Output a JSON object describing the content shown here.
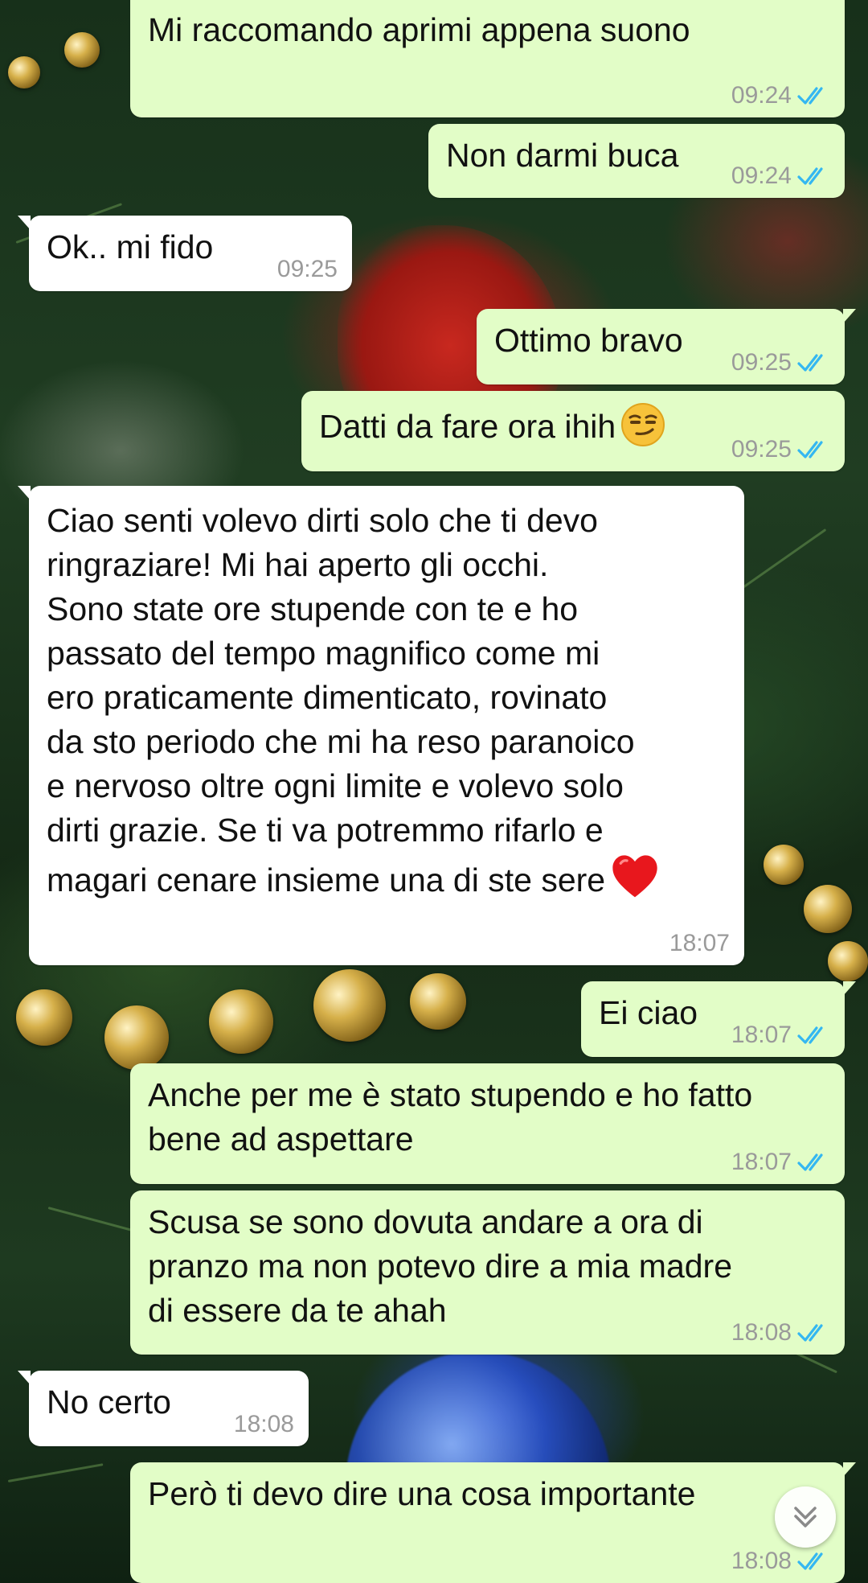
{
  "messages": [
    {
      "direction": "out",
      "text": "Mi raccomando aprimi appena suono",
      "time": "09:24",
      "status": "read"
    },
    {
      "direction": "out",
      "text": "Non darmi buca",
      "time": "09:24",
      "status": "read"
    },
    {
      "direction": "in",
      "text": "Ok.. mi fido",
      "time": "09:25"
    },
    {
      "direction": "out",
      "text": "Ottimo bravo",
      "time": "09:25",
      "status": "read"
    },
    {
      "direction": "out",
      "text": "Datti da fare ora ihih",
      "emoji": "smirking-face",
      "time": "09:25",
      "status": "read"
    },
    {
      "direction": "in",
      "text": "Ciao senti volevo dirti solo che ti devo\nringraziare! Mi hai aperto gli occhi.\nSono state ore stupende con te e ho\npassato del tempo magnifico come mi\nero praticamente dimenticato, rovinato\nda sto periodo che mi ha reso paranoico\ne nervoso oltre ogni limite e volevo solo\ndirti grazie. Se ti va potremmo rifarlo e\nmagari cenare insieme una di ste sere",
      "emoji": "red-heart",
      "time": "18:07"
    },
    {
      "direction": "out",
      "text": "Ei ciao",
      "time": "18:07",
      "status": "read"
    },
    {
      "direction": "out",
      "text": "Anche per me è stato stupendo e ho fatto\nbene ad aspettare",
      "time": "18:07",
      "status": "read"
    },
    {
      "direction": "out",
      "text": "Scusa se sono dovuta andare a ora di\npranzo ma non potevo dire a mia madre\ndi essere da te ahah",
      "time": "18:08",
      "status": "read"
    },
    {
      "direction": "in",
      "text": "No certo",
      "time": "18:08"
    },
    {
      "direction": "out",
      "text": "Però ti devo dire una cosa importante",
      "time": "18:08",
      "status": "read"
    }
  ],
  "icons": {
    "read_receipt": "double-check-icon",
    "scroll_down": "chevron-double-down-icon"
  },
  "colors": {
    "outgoing_bubble": "#e2fdc7",
    "incoming_bubble": "#ffffff",
    "read_tick": "#34b7f1",
    "timestamp": "#9a9a9a"
  }
}
